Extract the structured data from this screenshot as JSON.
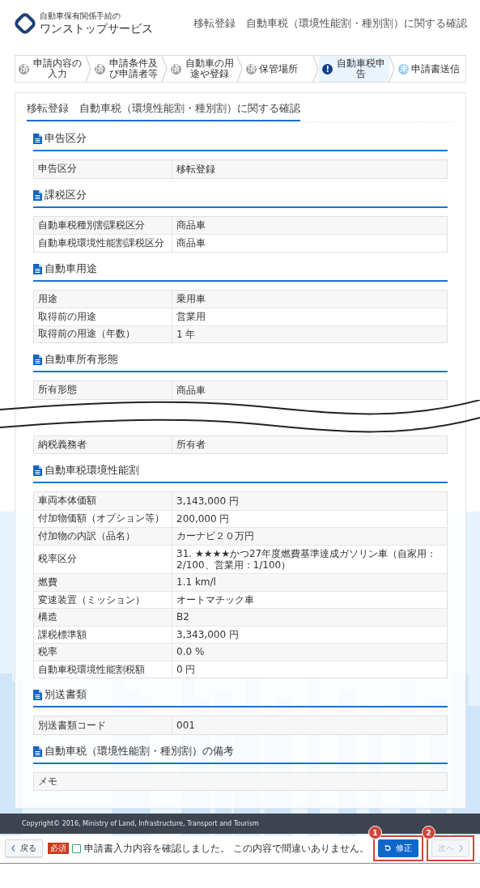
{
  "header": {
    "logo_subtitle": "自動車保有関係手続の",
    "logo_title": "ワンストップサービス",
    "page_title": "移転登録　自動車税（環境性能割・種別割）に関する確認"
  },
  "steps": [
    {
      "badge": "済",
      "label": "申請内容の入力",
      "done": true,
      "current": false
    },
    {
      "badge": "済",
      "label": "申請条件及び申請者等",
      "done": true,
      "current": false
    },
    {
      "badge": "済",
      "label": "自動車の用途や登録",
      "done": true,
      "current": false
    },
    {
      "badge": "済",
      "label": "保管場所",
      "done": true,
      "current": false
    },
    {
      "badge": "!",
      "label": "自動車税申告",
      "done": false,
      "current": true
    },
    {
      "badge": "未",
      "label": "申請書送信",
      "done": false,
      "current": false
    }
  ],
  "card_title": "移転登録　自動車税（環境性能割・種別割）に関する確認",
  "sections": [
    {
      "title": "申告区分",
      "rows": [
        {
          "label": "申告区分",
          "value": "移転登録"
        }
      ]
    },
    {
      "title": "課税区分",
      "rows": [
        {
          "label": "自動車税種別割課税区分",
          "value": "商品車"
        },
        {
          "label": "自動車税環境性能割課税区分",
          "value": "商品車"
        }
      ]
    },
    {
      "title": "自動車用途",
      "rows": [
        {
          "label": "用途",
          "value": "乗用車"
        },
        {
          "label": "取得前の用途",
          "value": "営業用"
        },
        {
          "label": "取得前の用途（年数）",
          "value": "1 年"
        }
      ]
    },
    {
      "title": "自動車所有形態",
      "rows": [
        {
          "label": "所有形態",
          "value": "商品車"
        }
      ]
    },
    {
      "break_before": true,
      "rows": [
        {
          "label": "納税義務者",
          "value": "所有者"
        }
      ]
    },
    {
      "title": "自動車税環境性能割",
      "rows": [
        {
          "label": "車両本体価額",
          "value": "3,143,000 円"
        },
        {
          "label": "付加物価額（オプション等）",
          "value": "200,000 円"
        },
        {
          "label": "付加物の内訳（品名）",
          "value": "カーナビ２０万円"
        },
        {
          "label": "税率区分",
          "value": "31. ★★★★かつ27年度燃費基準達成ガソリン車（自家用：2/100、営業用：1/100）"
        },
        {
          "label": "燃費",
          "value": "1.1 km/l"
        },
        {
          "label": "変速装置（ミッション）",
          "value": "オートマチック車"
        },
        {
          "label": "構造",
          "value": "B2"
        },
        {
          "label": "課税標準額",
          "value": "3,343,000 円"
        },
        {
          "label": "税率",
          "value": "0.0 %"
        },
        {
          "label": "自動車税環境性能割税額",
          "value": "0 円"
        }
      ]
    },
    {
      "title": "別送書類",
      "rows": [
        {
          "label": "別送書類コード",
          "value": "001"
        }
      ]
    },
    {
      "title": "自動車税（環境性能割・種別割）の備考",
      "rows": [
        {
          "label": "メモ"
        }
      ]
    }
  ],
  "copyright": "Copyright© 2016, Ministry of Land, Infrastructure, Transport and Tourism",
  "actions": {
    "back": {
      "label": "戻る"
    },
    "required_badge": "必須",
    "confirm": {
      "label": "申請書入力内容を確認しました。 この内容で間違いありません。",
      "checked": false
    },
    "buttons": [
      {
        "kind": "fix",
        "label": "修正",
        "disabled": false,
        "callout": "1"
      },
      {
        "kind": "next",
        "label": "次へ",
        "disabled": true,
        "callout": "2"
      }
    ]
  }
}
